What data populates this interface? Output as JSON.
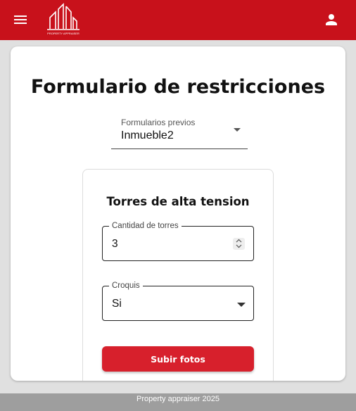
{
  "header": {
    "brand_logo_text": "PROPERTY APPRAISER",
    "menu_icon": "menu-icon",
    "user_icon": "person-icon",
    "color": "#c8111b"
  },
  "form": {
    "title": "Formulario de restricciones",
    "previous_forms": {
      "label": "Formularios previos",
      "value": "Inmueble2"
    },
    "section": {
      "title": "Torres de alta tension",
      "tower_count": {
        "label": "Cantidad de torres",
        "value": "3"
      },
      "sketch": {
        "label": "Croquis",
        "value": "Si"
      },
      "upload_button": "Subir fotos",
      "button_color": "#d7202c"
    }
  },
  "footer": {
    "text": "Property appraiser 2025"
  }
}
